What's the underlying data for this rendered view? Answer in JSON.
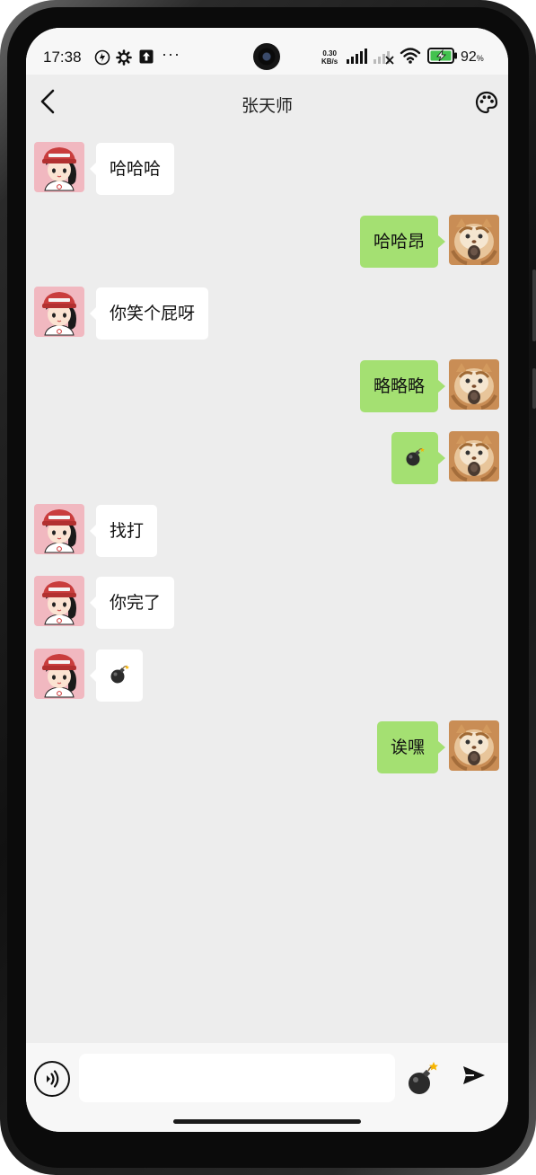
{
  "status_bar": {
    "time": "17:38",
    "icons_left": [
      "data-saver-icon",
      "gear-icon",
      "upload-icon"
    ],
    "more": "···",
    "net_speed_value": "0.30",
    "net_speed_unit": "KB/s",
    "battery_level": "92",
    "battery_unit": "%"
  },
  "header": {
    "title": "张天师"
  },
  "messages": [
    {
      "side": "left",
      "text": "哈哈哈"
    },
    {
      "side": "right",
      "text": "哈哈昂"
    },
    {
      "side": "left",
      "text": "你笑个屁呀"
    },
    {
      "side": "right",
      "text": "略略略"
    },
    {
      "side": "right",
      "emoji": "bomb-icon"
    },
    {
      "side": "left",
      "text": "找打"
    },
    {
      "side": "left",
      "text": "你完了"
    },
    {
      "side": "left",
      "emoji": "bomb-icon"
    },
    {
      "side": "right",
      "text": "诶嘿"
    }
  ],
  "input_bar": {
    "value": "",
    "placeholder": ""
  },
  "colors": {
    "sent_bubble": "#a4e072",
    "received_bubble": "#ffffff",
    "chat_background": "#ededed"
  }
}
